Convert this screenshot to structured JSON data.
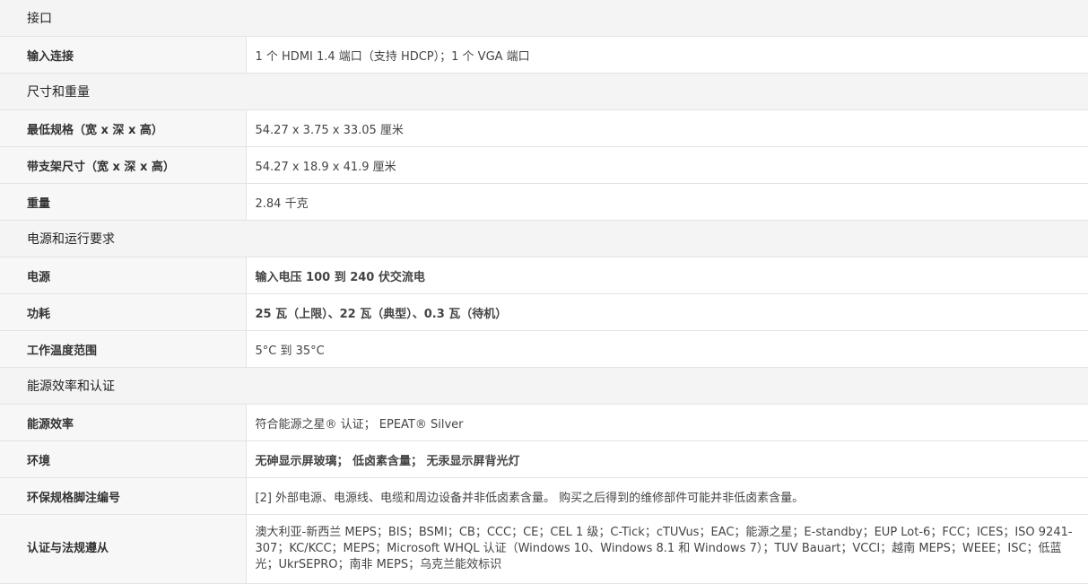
{
  "sections": [
    {
      "title": "接口",
      "rows": [
        {
          "label": "输入连接",
          "value": "1 个 HDMI 1.4 端口（支持 HDCP）；1 个 VGA 端口"
        }
      ]
    },
    {
      "title": "尺寸和重量",
      "rows": [
        {
          "label": "最低规格（宽 x 深 x 高）",
          "value": "54.27 x 3.75 x 33.05 厘米"
        },
        {
          "label": "带支架尺寸（宽 x 深 x 高）",
          "value": "54.27 x 18.9 x 41.9 厘米"
        },
        {
          "label": "重量",
          "value": "2.84 千克"
        }
      ]
    },
    {
      "title": "电源和运行要求",
      "rows": [
        {
          "label": "电源",
          "value": "输入电压 100 到 240 伏交流电"
        },
        {
          "label": "功耗",
          "value": "25 瓦（上限）、22 瓦（典型）、0.3 瓦（待机）"
        },
        {
          "label": "工作温度范围",
          "value": "5°C 到 35°C"
        }
      ]
    },
    {
      "title": "能源效率和认证",
      "rows": [
        {
          "label": "能源效率",
          "value": "符合能源之星® 认证； EPEAT® Silver"
        },
        {
          "label": "环境",
          "value": "无砷显示屏玻璃； 低卤素含量； 无汞显示屏背光灯"
        },
        {
          "label": "环保规格脚注编号",
          "value": "[2] 外部电源、电源线、电缆和周边设备并非低卤素含量。 购买之后得到的维修部件可能并非低卤素含量。"
        },
        {
          "label": "认证与法规遵从",
          "value": "澳大利亚-新西兰 MEPS；BIS；BSMI；CB；CCC；CE；CEL 1 级；C-Tick；cTUVus；EAC；能源之星；E-standby；EUP Lot-6；FCC；ICES；ISO 9241-307；KC/KCC；MEPS；Microsoft WHQL 认证（Windows 10、Windows 8.1 和 Windows 7）；TUV Bauart；VCCI；越南 MEPS；WEEE；ISC；低蓝光；UkrSEPRO；南非 MEPS；乌克兰能效标识"
        }
      ]
    }
  ]
}
